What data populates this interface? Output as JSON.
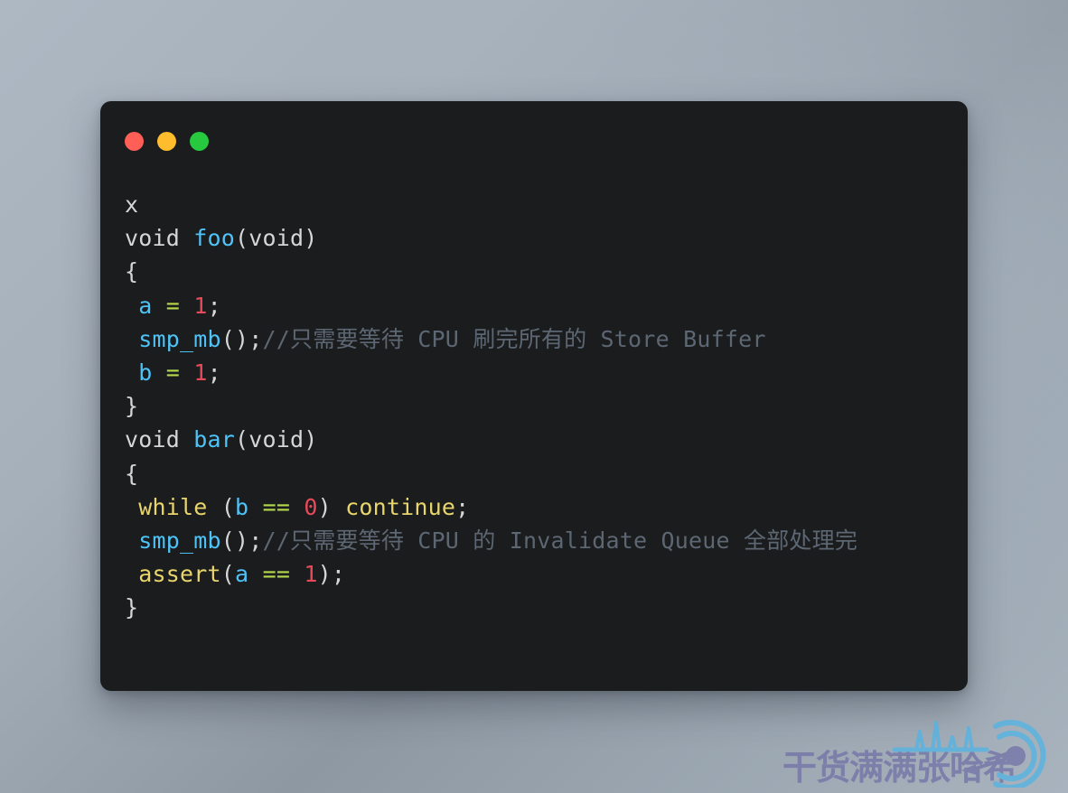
{
  "window": {
    "title": "code-snippet-window",
    "background_hex": "#1b1c1d",
    "traffic_lights": [
      {
        "name": "close",
        "color": "#ff5f56"
      },
      {
        "name": "minimize",
        "color": "#ffbd2e"
      },
      {
        "name": "maximize",
        "color": "#27c93f"
      }
    ]
  },
  "colors": {
    "page_background_start": "#aeb8c3",
    "page_background_end": "#8e98a2",
    "code_plain": "#d6d6d6",
    "code_function": "#4ec3f7",
    "code_variable": "#4ec3f7",
    "code_keyword": "#e8d56b",
    "code_number": "#e64a5a",
    "code_operator": "#b5d94c",
    "code_comment": "#5c6773",
    "watermark_text": "#6f6fa6",
    "watermark_mark": "#4db4e8"
  },
  "code": {
    "language": "c",
    "lines": [
      {
        "id": 1,
        "text": "x",
        "tokens": [
          {
            "t": "x",
            "c": "plain"
          }
        ]
      },
      {
        "id": 2,
        "text": "void foo(void)",
        "tokens": [
          {
            "t": "void ",
            "c": "plain"
          },
          {
            "t": "foo",
            "c": "fn"
          },
          {
            "t": "(void)",
            "c": "punct"
          }
        ]
      },
      {
        "id": 3,
        "text": "{",
        "tokens": [
          {
            "t": "{",
            "c": "punct"
          }
        ]
      },
      {
        "id": 4,
        "text": " a = 1;",
        "tokens": [
          {
            "t": " ",
            "c": "plain"
          },
          {
            "t": "a",
            "c": "var"
          },
          {
            "t": " ",
            "c": "plain"
          },
          {
            "t": "=",
            "c": "op"
          },
          {
            "t": " ",
            "c": "plain"
          },
          {
            "t": "1",
            "c": "num"
          },
          {
            "t": ";",
            "c": "punct"
          }
        ]
      },
      {
        "id": 5,
        "text": " smp_mb();//只需要等待 CPU 刷完所有的 Store Buffer",
        "tokens": [
          {
            "t": " ",
            "c": "plain"
          },
          {
            "t": "smp_mb",
            "c": "fn"
          },
          {
            "t": "();",
            "c": "punct"
          },
          {
            "t": "//只需要等待 CPU 刷完所有的 Store Buffer",
            "c": "comment"
          }
        ]
      },
      {
        "id": 6,
        "text": " b = 1;",
        "tokens": [
          {
            "t": " ",
            "c": "plain"
          },
          {
            "t": "b",
            "c": "var"
          },
          {
            "t": " ",
            "c": "plain"
          },
          {
            "t": "=",
            "c": "op"
          },
          {
            "t": " ",
            "c": "plain"
          },
          {
            "t": "1",
            "c": "num"
          },
          {
            "t": ";",
            "c": "punct"
          }
        ]
      },
      {
        "id": 7,
        "text": "}",
        "tokens": [
          {
            "t": "}",
            "c": "punct"
          }
        ]
      },
      {
        "id": 8,
        "text": "void bar(void)",
        "tokens": [
          {
            "t": "void ",
            "c": "plain"
          },
          {
            "t": "bar",
            "c": "fn"
          },
          {
            "t": "(void)",
            "c": "punct"
          }
        ]
      },
      {
        "id": 9,
        "text": "{",
        "tokens": [
          {
            "t": "{",
            "c": "punct"
          }
        ]
      },
      {
        "id": 10,
        "text": " while (b == 0) continue;",
        "tokens": [
          {
            "t": " ",
            "c": "plain"
          },
          {
            "t": "while",
            "c": "kw"
          },
          {
            "t": " (",
            "c": "punct"
          },
          {
            "t": "b",
            "c": "var"
          },
          {
            "t": " ",
            "c": "plain"
          },
          {
            "t": "==",
            "c": "op"
          },
          {
            "t": " ",
            "c": "plain"
          },
          {
            "t": "0",
            "c": "num"
          },
          {
            "t": ") ",
            "c": "punct"
          },
          {
            "t": "continue",
            "c": "kw"
          },
          {
            "t": ";",
            "c": "punct"
          }
        ]
      },
      {
        "id": 11,
        "text": " smp_mb();//只需要等待 CPU 的 Invalidate Queue 全部处理完",
        "tokens": [
          {
            "t": " ",
            "c": "plain"
          },
          {
            "t": "smp_mb",
            "c": "fn"
          },
          {
            "t": "();",
            "c": "punct"
          },
          {
            "t": "//只需要等待 CPU 的 Invalidate Queue 全部处理完",
            "c": "comment"
          }
        ]
      },
      {
        "id": 12,
        "text": " assert(a == 1);",
        "tokens": [
          {
            "t": " ",
            "c": "plain"
          },
          {
            "t": "assert",
            "c": "kw"
          },
          {
            "t": "(",
            "c": "punct"
          },
          {
            "t": "a",
            "c": "var"
          },
          {
            "t": " ",
            "c": "plain"
          },
          {
            "t": "==",
            "c": "op"
          },
          {
            "t": " ",
            "c": "plain"
          },
          {
            "t": "1",
            "c": "num"
          },
          {
            "t": ");",
            "c": "punct"
          }
        ]
      },
      {
        "id": 13,
        "text": "}",
        "tokens": [
          {
            "t": "}",
            "c": "punct"
          }
        ]
      }
    ]
  },
  "watermark": {
    "text": "干货满满张哈希",
    "mark_name": "radar-signal-icon"
  }
}
